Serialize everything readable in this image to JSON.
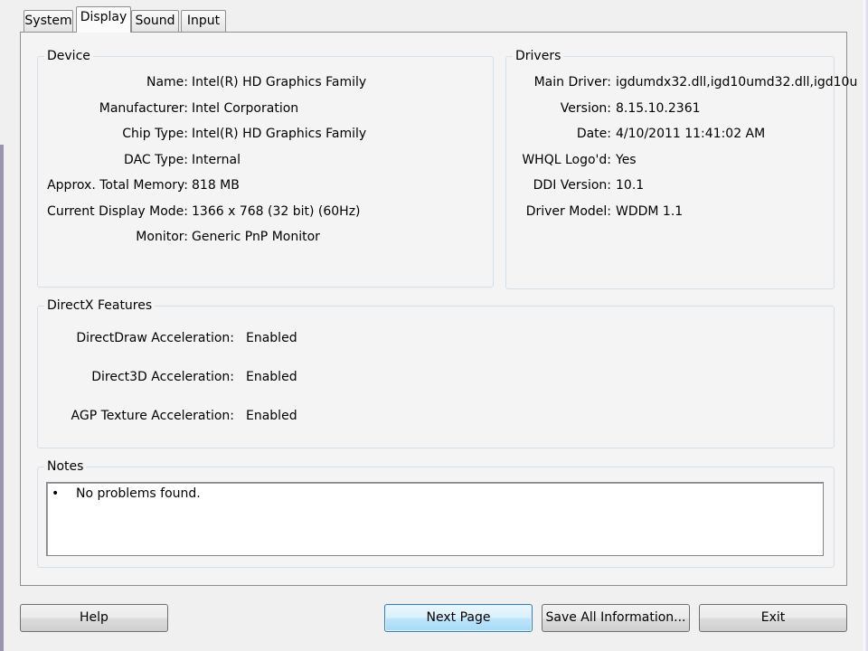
{
  "tabs": [
    "System",
    "Display",
    "Sound",
    "Input"
  ],
  "active_tab": "Display",
  "device": {
    "title": "Device",
    "rows": [
      {
        "label": "Name:",
        "value": "Intel(R) HD Graphics Family"
      },
      {
        "label": "Manufacturer:",
        "value": "Intel Corporation"
      },
      {
        "label": "Chip Type:",
        "value": "Intel(R) HD Graphics Family"
      },
      {
        "label": "DAC Type:",
        "value": "Internal"
      },
      {
        "label": "Approx. Total Memory:",
        "value": "818 MB"
      },
      {
        "label": "Current Display Mode:",
        "value": "1366 x 768 (32 bit) (60Hz)"
      },
      {
        "label": "Monitor:",
        "value": "Generic PnP Monitor"
      }
    ]
  },
  "drivers": {
    "title": "Drivers",
    "rows": [
      {
        "label": "Main Driver:",
        "value": "igdumdx32.dll,igd10umd32.dll,igd10u"
      },
      {
        "label": "Version:",
        "value": "8.15.10.2361"
      },
      {
        "label": "Date:",
        "value": "4/10/2011 11:41:02 AM"
      },
      {
        "label": "WHQL Logo'd:",
        "value": "Yes"
      },
      {
        "label": "DDI Version:",
        "value": "10.1"
      },
      {
        "label": "Driver Model:",
        "value": "WDDM 1.1"
      }
    ]
  },
  "directx": {
    "title": "DirectX Features",
    "rows": [
      {
        "label": "DirectDraw Acceleration:",
        "value": "Enabled"
      },
      {
        "label": "Direct3D Acceleration:",
        "value": "Enabled"
      },
      {
        "label": "AGP Texture Acceleration:",
        "value": "Enabled"
      }
    ]
  },
  "notes": {
    "title": "Notes",
    "items": [
      "No problems found."
    ]
  },
  "buttons": {
    "help": "Help",
    "next_page": "Next Page",
    "save_all": "Save All Information...",
    "exit": "Exit"
  }
}
